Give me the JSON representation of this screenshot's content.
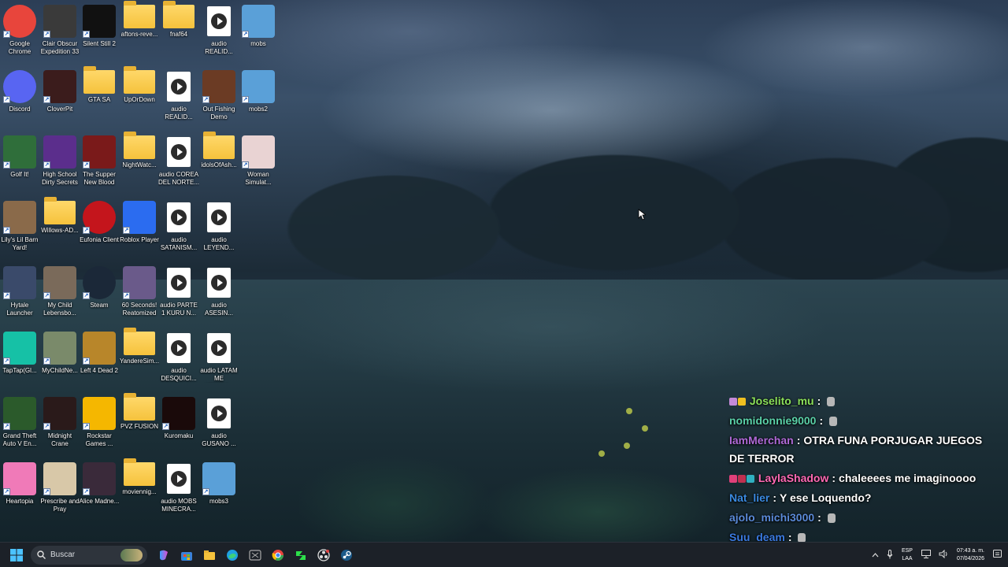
{
  "desktop": {
    "icons": [
      {
        "label": "Google Chrome",
        "icon": "chrome-icon",
        "kind": "app",
        "color": "#e8453c"
      },
      {
        "label": "Clair Obscur Expedition 33",
        "icon": "clair-obscur-icon",
        "kind": "app",
        "color": "#3a3a3a"
      },
      {
        "label": "Silent Still 2",
        "icon": "silent-still-icon",
        "kind": "app",
        "color": "#111111"
      },
      {
        "label": "aftons-reve...",
        "icon": "folder-icon",
        "kind": "folder"
      },
      {
        "label": "fnaf64",
        "icon": "folder-icon",
        "kind": "folder"
      },
      {
        "label": "audio REALID...",
        "icon": "audio-file-icon",
        "kind": "audio"
      },
      {
        "label": "mobs",
        "icon": "mobs-image-icon",
        "kind": "app",
        "color": "#5aa0d8"
      },
      {
        "label": "Discord",
        "icon": "discord-icon",
        "kind": "app",
        "color": "#5865f2"
      },
      {
        "label": "CloverPit",
        "icon": "cloverpit-icon",
        "kind": "app",
        "color": "#3b1c1c"
      },
      {
        "label": "GTA SA",
        "icon": "folder-icon",
        "kind": "folder"
      },
      {
        "label": "UpOrDown",
        "icon": "folder-icon",
        "kind": "folder"
      },
      {
        "label": "audio REALID...",
        "icon": "audio-file-icon",
        "kind": "audio"
      },
      {
        "label": "Out Fishing Demo",
        "icon": "out-fishing-icon",
        "kind": "app",
        "color": "#6b3b24"
      },
      {
        "label": "mobs2",
        "icon": "mobs2-image-icon",
        "kind": "app",
        "color": "#5aa0d8"
      },
      {
        "label": "Golf It!",
        "icon": "golf-it-icon",
        "kind": "app",
        "color": "#2f6e3a"
      },
      {
        "label": "High School Dirty Secrets",
        "icon": "high-school-icon",
        "kind": "app",
        "color": "#5b2e8c"
      },
      {
        "label": "The Supper New Blood",
        "icon": "supper-icon",
        "kind": "app",
        "color": "#7a1a1a"
      },
      {
        "label": "NightWatc...",
        "icon": "folder-icon",
        "kind": "folder"
      },
      {
        "label": "audio COREA DEL NORTE...",
        "icon": "audio-file-icon",
        "kind": "audio"
      },
      {
        "label": "idolsOfAsh...",
        "icon": "folder-icon",
        "kind": "folder"
      },
      {
        "label": "Woman Simulat...",
        "icon": "woman-simulator-icon",
        "kind": "app",
        "color": "#e9d3d3"
      },
      {
        "label": "Lily's Lil Barn Yard!",
        "icon": "lily-barn-icon",
        "kind": "app",
        "color": "#8a6a4a"
      },
      {
        "label": "Willows-AD...",
        "icon": "folder-icon",
        "kind": "folder"
      },
      {
        "label": "Eufonia Client",
        "icon": "eufonia-icon",
        "kind": "app",
        "color": "#c4151c"
      },
      {
        "label": "Roblox Player",
        "icon": "roblox-icon",
        "kind": "app",
        "color": "#2b6cf0"
      },
      {
        "label": "audio SATANISM...",
        "icon": "audio-file-icon",
        "kind": "audio"
      },
      {
        "label": "audio LEYEND...",
        "icon": "audio-file-icon",
        "kind": "audio"
      },
      {
        "label": "Hytale Launcher",
        "icon": "hytale-icon",
        "kind": "app",
        "color": "#3a4a6a"
      },
      {
        "label": "My Child Lebensbo...",
        "icon": "my-child-icon",
        "kind": "app",
        "color": "#7a6a5a"
      },
      {
        "label": "Steam",
        "icon": "steam-icon",
        "kind": "app",
        "color": "#1b2838"
      },
      {
        "label": "60 Seconds! Reatomized",
        "icon": "sixty-seconds-icon",
        "kind": "app",
        "color": "#6a5a8a"
      },
      {
        "label": "audio PARTE 1 KURU N...",
        "icon": "audio-file-icon",
        "kind": "audio"
      },
      {
        "label": "audio ASESIN...",
        "icon": "audio-file-icon",
        "kind": "audio"
      },
      {
        "label": "TapTap(Gl...",
        "icon": "taptap-icon",
        "kind": "app",
        "color": "#16c1a6"
      },
      {
        "label": "MyChildNe...",
        "icon": "my-child-new-icon",
        "kind": "app",
        "color": "#7a8a6a"
      },
      {
        "label": "Left 4 Dead 2",
        "icon": "left4dead-icon",
        "kind": "app",
        "color": "#b8862a"
      },
      {
        "label": "YandereSim...",
        "icon": "folder-icon",
        "kind": "folder"
      },
      {
        "label": "audio DESQUICI...",
        "icon": "audio-file-icon",
        "kind": "audio"
      },
      {
        "label": "audio LATAM ME ATERRA...",
        "icon": "audio-file-icon",
        "kind": "audio"
      },
      {
        "label": "Grand Theft Auto V En...",
        "icon": "gta-v-icon",
        "kind": "app",
        "color": "#2b5a2b"
      },
      {
        "label": "Midnight Crane",
        "icon": "midnight-crane-icon",
        "kind": "app",
        "color": "#2a1a1a"
      },
      {
        "label": "Rockstar Games ...",
        "icon": "rockstar-icon",
        "kind": "app",
        "color": "#f5b700"
      },
      {
        "label": "PVZ FUSION",
        "icon": "folder-icon",
        "kind": "folder"
      },
      {
        "label": "Kuromaku",
        "icon": "kuromaku-icon",
        "kind": "app",
        "color": "#1a0a0a"
      },
      {
        "label": "audio GUSANO ...",
        "icon": "audio-file-icon",
        "kind": "audio"
      },
      {
        "label": "Heartopia",
        "icon": "heartopia-icon",
        "kind": "app",
        "color": "#f07ab8"
      },
      {
        "label": "Prescribe and Pray",
        "icon": "prescribe-pray-icon",
        "kind": "app",
        "color": "#d8c8a8"
      },
      {
        "label": "Alice Madne...",
        "icon": "alice-madness-icon",
        "kind": "app",
        "color": "#3a2a3a"
      },
      {
        "label": "moviennig...",
        "icon": "folder-icon",
        "kind": "folder"
      },
      {
        "label": "audio MOBS MINECRA...",
        "icon": "audio-file-icon",
        "kind": "audio"
      },
      {
        "label": "mobs3",
        "icon": "mobs3-image-icon",
        "kind": "app",
        "color": "#5aa0d8"
      }
    ]
  },
  "chat": {
    "messages": [
      {
        "user": "Joselito_mu",
        "user_color": "#8be05a",
        "text": "",
        "badges": [
          "#c48ad8",
          "#f0c020"
        ],
        "emote": true
      },
      {
        "user": "nomidonnie9000",
        "user_color": "#5ad0a8",
        "text": "",
        "badges": [],
        "emote": true
      },
      {
        "user": "IamMerchan",
        "user_color": "#b06ad8",
        "text": "OTRA FUNA PORJUGAR JUEGOS DE TERROR",
        "badges": [],
        "emote": false
      },
      {
        "user": "LaylaShadow",
        "user_color": "#ff69b4",
        "text": "chaleeees me imaginoooo",
        "badges": [
          "#e0407a",
          "#c03050",
          "#30b0c0"
        ],
        "emote": false
      },
      {
        "user": "Nat_lier",
        "user_color": "#3a8ae0",
        "text": "Y ese Loquendo?",
        "badges": [],
        "emote": false
      },
      {
        "user": "ajolo_michi3000",
        "user_color": "#5a8ad8",
        "text": "",
        "badges": [],
        "emote": true
      },
      {
        "user": "Suu_deam",
        "user_color": "#3a7ae0",
        "text": "",
        "badges": [],
        "emote": true
      }
    ],
    "separator": ":"
  },
  "taskbar": {
    "search_placeholder": "Buscar",
    "apps": [
      "copilot-icon",
      "microsoft-store-icon",
      "file-explorer-icon",
      "edge-icon",
      "xbox-icon",
      "chrome-icon",
      "game-app-icon",
      "obs-icon",
      "steam-icon"
    ],
    "lang_line1": "ESP",
    "lang_line2": "LAA",
    "time": "07:43 a. m.",
    "date": "07/04/2026"
  }
}
